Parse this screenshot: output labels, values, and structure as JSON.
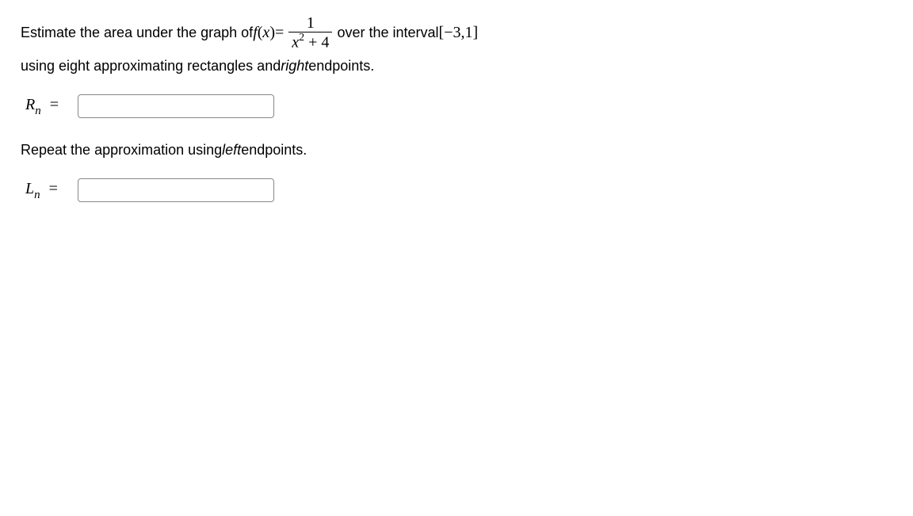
{
  "problem": {
    "line1_part1": "Estimate the area under the graph of ",
    "func_f": "f",
    "func_paren_open": "(",
    "func_x": "x",
    "func_paren_close": ")",
    "equals": " = ",
    "frac_num": "1",
    "frac_den_x": "x",
    "frac_den_sup": "2",
    "frac_den_plus": " + 4",
    "line1_part2": " over the interval ",
    "interval_open": "[",
    "interval_minus": " − ",
    "interval_a": "3",
    "interval_comma": ", ",
    "interval_b": "1",
    "interval_close": "]",
    "line2_part1": "using eight approximating rectangles and ",
    "line2_right": "right",
    "line2_part2": " endpoints."
  },
  "rn": {
    "label_R": "R",
    "label_n": "n",
    "equals": "=",
    "value": ""
  },
  "repeat": {
    "part1": "Repeat the approximation using ",
    "left_word": "left",
    "part2": " endpoints."
  },
  "ln": {
    "label_L": "L",
    "label_n": "n",
    "equals": "=",
    "value": ""
  }
}
